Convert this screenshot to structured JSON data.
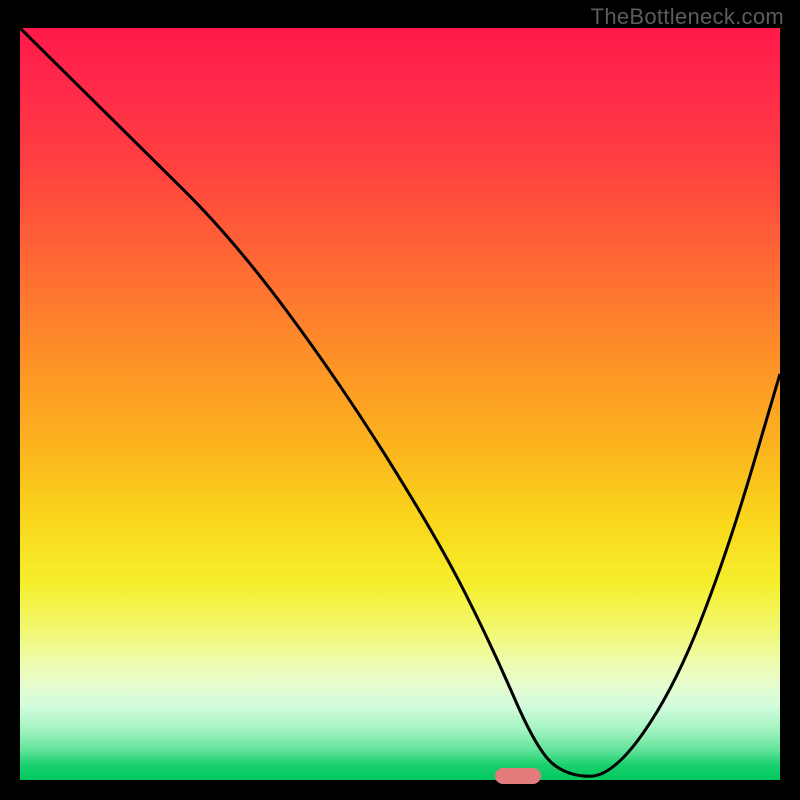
{
  "watermark": "TheBottleneck.com",
  "chart_data": {
    "type": "line",
    "title": "",
    "xlabel": "",
    "ylabel": "",
    "xlim": [
      0,
      100
    ],
    "ylim": [
      0,
      100
    ],
    "grid": false,
    "legend": false,
    "series": [
      {
        "name": "bottleneck-curve",
        "x": [
          0,
          15,
          28,
          42,
          55,
          62,
          68,
          72,
          78,
          86,
          93,
          100
        ],
        "values": [
          100,
          85,
          72,
          53,
          32,
          18,
          4,
          0.5,
          0.5,
          12,
          30,
          54
        ]
      }
    ],
    "marker": {
      "x": 65.5,
      "y": 0.5
    },
    "gradient_stops": [
      {
        "pct": 0,
        "color": "#ff1a4a"
      },
      {
        "pct": 8,
        "color": "#ff2a4a"
      },
      {
        "pct": 18,
        "color": "#ff4040"
      },
      {
        "pct": 32,
        "color": "#fe6b33"
      },
      {
        "pct": 44,
        "color": "#fd9127"
      },
      {
        "pct": 56,
        "color": "#fcb51e"
      },
      {
        "pct": 66,
        "color": "#f9d81b"
      },
      {
        "pct": 74,
        "color": "#f6ef2e"
      },
      {
        "pct": 80,
        "color": "#f2f870"
      },
      {
        "pct": 84,
        "color": "#eefba8"
      },
      {
        "pct": 87,
        "color": "#e8fccc"
      },
      {
        "pct": 90,
        "color": "#d4fcdc"
      },
      {
        "pct": 93,
        "color": "#a9f5c5"
      },
      {
        "pct": 96,
        "color": "#62e39a"
      },
      {
        "pct": 98,
        "color": "#1bd06e"
      },
      {
        "pct": 100,
        "color": "#00c95f"
      }
    ]
  }
}
